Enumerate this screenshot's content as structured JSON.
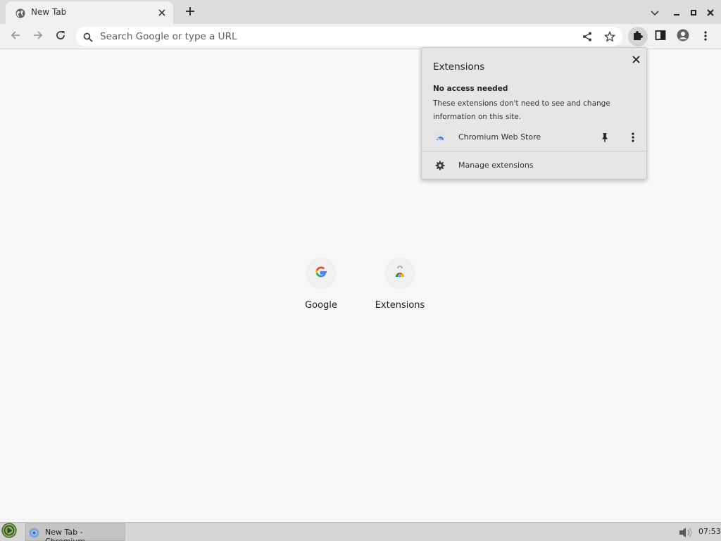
{
  "colors": {
    "tabstrip_bg": "#dcdcdc",
    "toolbar_bg": "#f1f1f1",
    "page_bg": "#f7f7f7",
    "popup_bg": "#e6e6e6",
    "icon_gray": "#5f5f5f",
    "icon_dark": "#3c3c3c"
  },
  "tab": {
    "title": "New Tab",
    "favicon": "chromium-globe-icon",
    "close_icon": "close-icon"
  },
  "tabstrip": {
    "new_tab_icon": "plus-icon",
    "tab_search_icon": "chevron-down-icon",
    "minimize_icon": "minimize-icon",
    "maximize_icon": "maximize-icon",
    "close_icon": "close-icon"
  },
  "toolbar": {
    "back_icon": "arrow-left-icon",
    "forward_icon": "arrow-right-icon",
    "reload_icon": "reload-icon",
    "omnibox": {
      "placeholder": "Search Google or type a URL",
      "value": ""
    },
    "share_icon": "share-icon",
    "bookmark_icon": "star-icon",
    "extensions_icon": "puzzle-icon",
    "side_panel_icon": "side-panel-icon",
    "profile_icon": "profile-icon",
    "menu_icon": "kebab-menu-icon"
  },
  "shortcuts": [
    {
      "label": "Google",
      "icon": "google-g-icon"
    },
    {
      "label": "Extensions",
      "icon": "chrome-web-store-icon"
    }
  ],
  "extensions_popup": {
    "title": "Extensions",
    "section_title": "No access needed",
    "section_description": "These extensions don't need to see and change information on this site.",
    "items": [
      {
        "name": "Chromium Web Store",
        "pin_icon": "pin-icon",
        "more_icon": "kebab-menu-icon"
      }
    ],
    "manage_label": "Manage extensions",
    "manage_icon": "gear-icon"
  },
  "taskbar": {
    "start_icon": "start-menu-icon",
    "tasks": [
      {
        "label": "New Tab - Chromium",
        "icon": "chromium-icon"
      }
    ],
    "volume_icon": "volume-icon",
    "clock": "07:53"
  }
}
